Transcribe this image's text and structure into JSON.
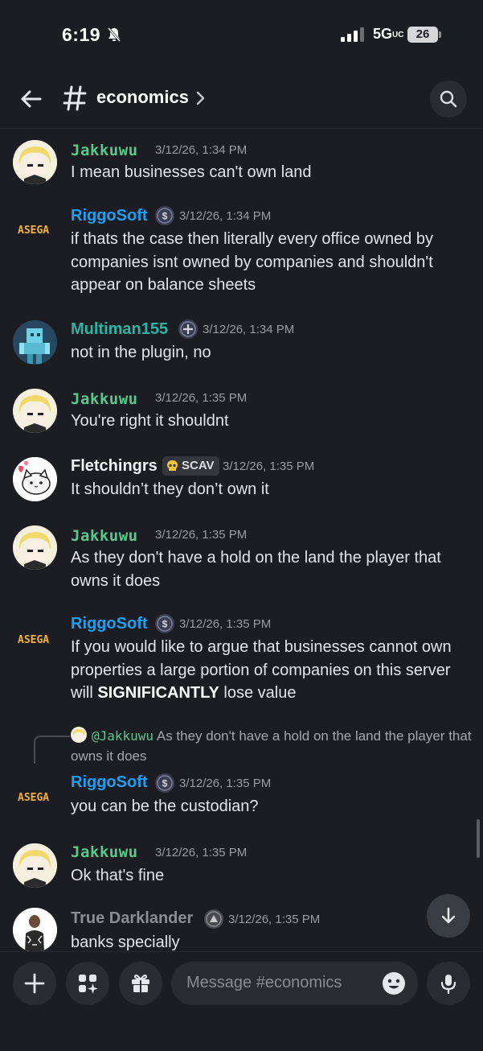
{
  "status_bar": {
    "time": "6:19",
    "network": "5G",
    "network_suffix": "UC",
    "battery": "26"
  },
  "header": {
    "channel": "economics"
  },
  "messages": [
    {
      "author": "Jakkuwu",
      "timestamp": "3/12/26, 1:34 PM",
      "text": "I mean businesses can't own land"
    },
    {
      "author": "RiggoSoft",
      "timestamp": "3/12/26, 1:34 PM",
      "text": "if thats the case then literally every office owned by companies isnt owned by companies and shouldn't appear on balance sheets",
      "avatar_text": "ASEGA"
    },
    {
      "author": "Multiman155",
      "timestamp": "3/12/26, 1:34 PM",
      "text": "not in the plugin, no"
    },
    {
      "author": "Jakkuwu",
      "timestamp": "3/12/26, 1:35 PM",
      "text": "You're right it shouldnt"
    },
    {
      "author": "Fletchingrs",
      "tag": "SCAV",
      "timestamp": "3/12/26, 1:35 PM",
      "text": "It shouldn’t they don’t own it"
    },
    {
      "author": "Jakkuwu",
      "timestamp": "3/12/26, 1:35 PM",
      "text": "As they don't have a hold on the land the player that owns it does"
    },
    {
      "author": "RiggoSoft",
      "timestamp": "3/12/26, 1:35 PM",
      "text_before": "If you would like to argue that businesses cannot own properties a large portion of companies on this server will ",
      "text_bold": "SIGNIFICANTLY",
      "text_after": " lose value",
      "avatar_text": "ASEGA"
    },
    {
      "author": "RiggoSoft",
      "timestamp": "3/12/26, 1:35 PM",
      "reply_mention": "@Jakkuwu",
      "reply_text": "As they don't have a hold on the land the player that owns it does",
      "text": "you can be the custodian?",
      "avatar_text": "ASEGA"
    },
    {
      "author": "Jakkuwu",
      "timestamp": "3/12/26, 1:35 PM",
      "text": "Ok that's fine"
    },
    {
      "author": "True Darklander",
      "timestamp": "3/12/26, 1:35 PM",
      "text": "banks specially"
    }
  ],
  "composer": {
    "placeholder": "Message #economics"
  },
  "colors": {
    "background": "#1c1d22",
    "jakkuwu": "#57c98a",
    "riggosoft": "#1f9ff1",
    "multiman": "#2bb3a6"
  }
}
